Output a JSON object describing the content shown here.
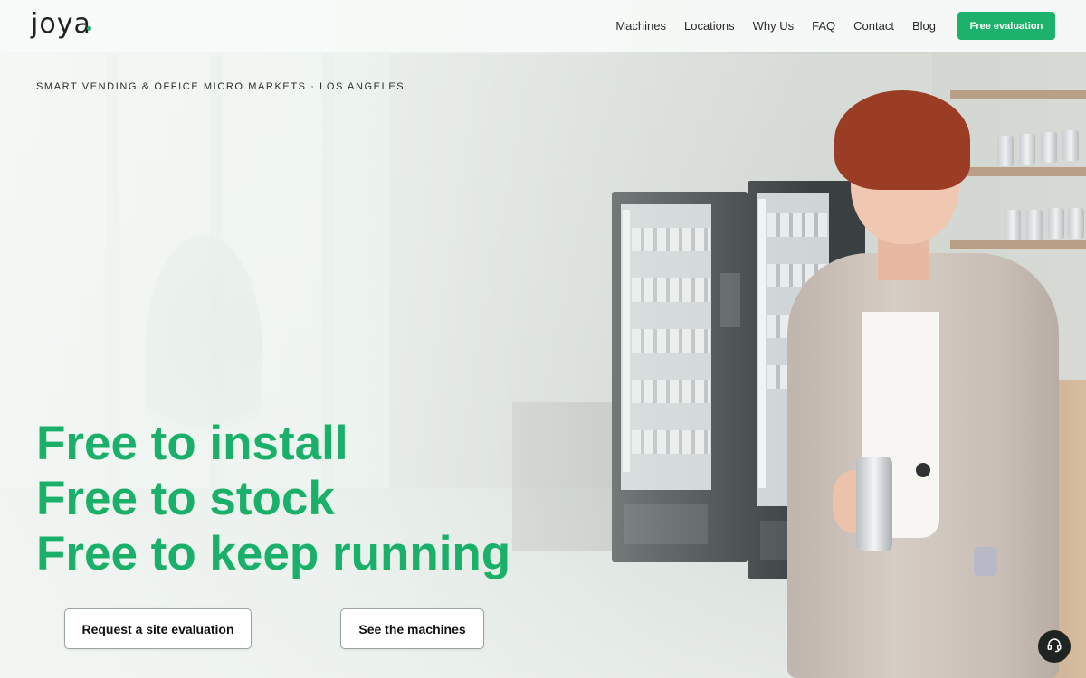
{
  "brand": {
    "logo_text": "joya",
    "accent": "#1cb26b"
  },
  "nav": {
    "items": [
      {
        "label": "Machines"
      },
      {
        "label": "Locations"
      },
      {
        "label": "Why Us"
      },
      {
        "label": "FAQ"
      },
      {
        "label": "Contact"
      },
      {
        "label": "Blog"
      }
    ],
    "cta_label": "Free evaluation"
  },
  "hero": {
    "eyebrow": "SMART VENDING & OFFICE MICRO MARKETS · LOS ANGELES",
    "headline": [
      "Free to install",
      "Free to stock",
      "Free to keep running"
    ],
    "primary_button": "Request a site evaluation",
    "secondary_button": "See the machines",
    "headline_color": "#1ab06a"
  },
  "support": {
    "icon": "headset-icon"
  }
}
